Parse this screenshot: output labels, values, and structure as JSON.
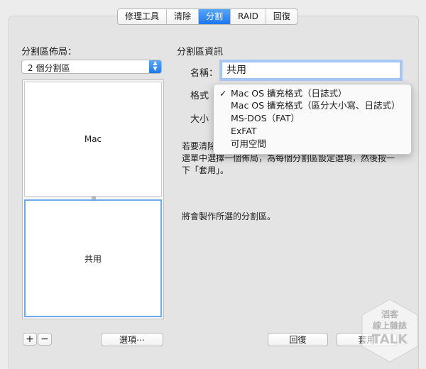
{
  "tabs": [
    {
      "label": "修理工具",
      "selected": false
    },
    {
      "label": "清除",
      "selected": false
    },
    {
      "label": "分割",
      "selected": true
    },
    {
      "label": "RAID",
      "selected": false
    },
    {
      "label": "回復",
      "selected": false
    }
  ],
  "left": {
    "layout_title": "分割區佈局：",
    "layout_popup": "2 個分割區",
    "partitions": [
      {
        "name": "Mac",
        "selected": false
      },
      {
        "name": "共用",
        "selected": true
      }
    ],
    "add_label": "+",
    "remove_label": "−",
    "options_button": "選項⋯"
  },
  "right": {
    "info_title": "分割區資訊",
    "name_label": "名稱：",
    "name_value": "共用",
    "format_label": "格式",
    "size_label": "大小",
    "desc_text_line1": "若要清除",
    "desc_text_line2": "選單中選擇一個佈局，為每個分割區設定選項，然後按一",
    "desc_text_line3": "下「套用」。",
    "create_text": "將會製作所選的分割區。",
    "revert_button": "回復",
    "apply_button": "套用"
  },
  "format_menu": {
    "items": [
      {
        "label": "Mac OS 擴充格式（日誌式）",
        "checked": true
      },
      {
        "label": "Mac OS 擴充格式（區分大小寫、日誌式）",
        "checked": false
      },
      {
        "label": "MS-DOS（FAT）",
        "checked": false
      },
      {
        "label": "ExFAT",
        "checked": false
      },
      {
        "label": "可用空間",
        "checked": false
      }
    ],
    "check_mark": "✓"
  },
  "watermark": {
    "line1": "滔客",
    "line2": "線上雜誌",
    "line3": "TALK"
  },
  "colors": {
    "accent": "#1d79f0",
    "panel": "#e4e4e4",
    "focus_ring": "#a8c9f5"
  }
}
